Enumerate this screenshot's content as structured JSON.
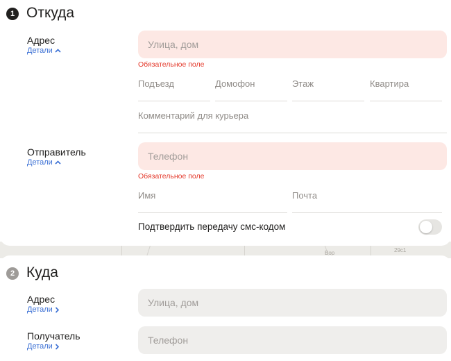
{
  "from": {
    "step": "1",
    "title": "Откуда",
    "address": {
      "label": "Адрес",
      "details": "Детали",
      "placeholder": "Улица, дом",
      "error": "Обязательное поле",
      "fields": {
        "entrance": "Подъезд",
        "intercom": "Домофон",
        "floor": "Этаж",
        "apartment": "Квартира"
      },
      "comment": "Комментарий для курьера"
    },
    "sender": {
      "label": "Отправитель",
      "details": "Детали",
      "placeholder": "Телефон",
      "error": "Обязательное поле",
      "name": "Имя",
      "email": "Почта"
    },
    "sms_confirm": {
      "label": "Подтвердить передачу смс-кодом",
      "enabled": false
    }
  },
  "map": {
    "labels": [
      "Вор",
      "29с1"
    ]
  },
  "to": {
    "step": "2",
    "title": "Куда",
    "address": {
      "label": "Адрес",
      "details": "Детали",
      "placeholder": "Улица, дом"
    },
    "recipient": {
      "label": "Получатель",
      "details": "Детали",
      "placeholder": "Телефон"
    }
  },
  "colors": {
    "error_bg": "#fde8e4",
    "error_text": "#e4392b",
    "link": "#3a6fd4",
    "field_bg": "#efeeec"
  }
}
